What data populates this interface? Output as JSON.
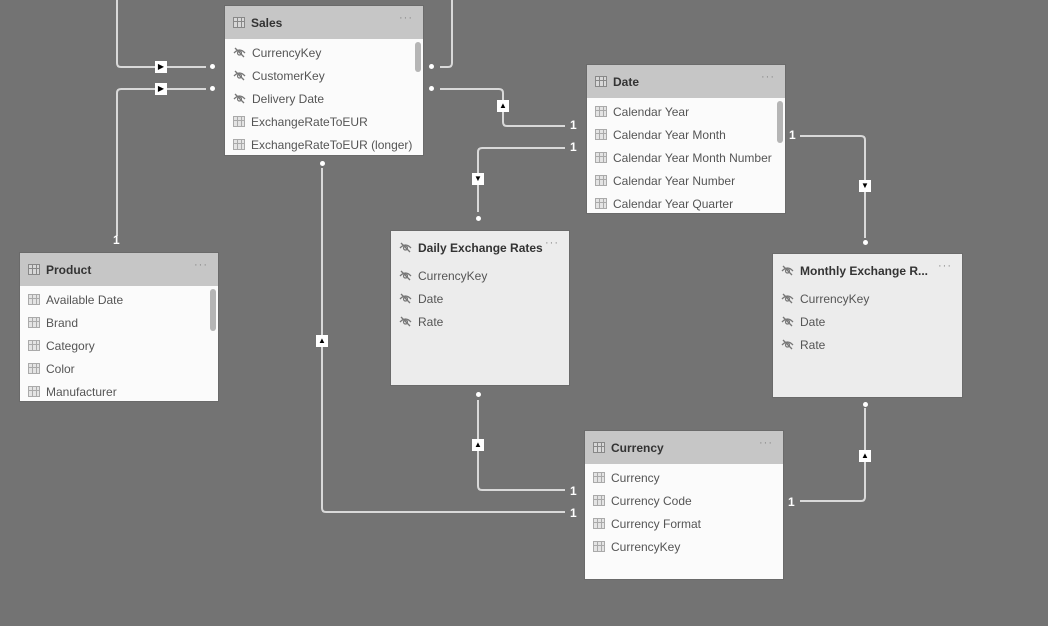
{
  "tables": {
    "sales": {
      "title": "Sales",
      "more": "···",
      "fields": [
        {
          "label": "CurrencyKey",
          "icon": "hidden"
        },
        {
          "label": "CustomerKey",
          "icon": "hidden"
        },
        {
          "label": "Delivery Date",
          "icon": "hidden"
        },
        {
          "label": "ExchangeRateToEUR",
          "icon": "column"
        },
        {
          "label": "ExchangeRateToEUR (longer)",
          "icon": "column"
        }
      ]
    },
    "date": {
      "title": "Date",
      "more": "···",
      "fields": [
        {
          "label": "Calendar Year",
          "icon": "column"
        },
        {
          "label": "Calendar Year Month",
          "icon": "column"
        },
        {
          "label": "Calendar Year Month Number",
          "icon": "column"
        },
        {
          "label": "Calendar Year Number",
          "icon": "column"
        },
        {
          "label": "Calendar Year Quarter",
          "icon": "column"
        }
      ]
    },
    "product": {
      "title": "Product",
      "more": "···",
      "fields": [
        {
          "label": "Available Date",
          "icon": "column"
        },
        {
          "label": "Brand",
          "icon": "column"
        },
        {
          "label": "Category",
          "icon": "column"
        },
        {
          "label": "Color",
          "icon": "column"
        },
        {
          "label": "Manufacturer",
          "icon": "column"
        }
      ]
    },
    "daily": {
      "title": "Daily Exchange Rates",
      "more": "···",
      "hidden": true,
      "fields": [
        {
          "label": "CurrencyKey",
          "icon": "hidden"
        },
        {
          "label": "Date",
          "icon": "hidden"
        },
        {
          "label": "Rate",
          "icon": "hidden"
        }
      ]
    },
    "monthly": {
      "title": "Monthly Exchange R...",
      "more": "···",
      "hidden": true,
      "fields": [
        {
          "label": "CurrencyKey",
          "icon": "hidden"
        },
        {
          "label": "Date",
          "icon": "hidden"
        },
        {
          "label": "Rate",
          "icon": "hidden"
        }
      ]
    },
    "currency": {
      "title": "Currency",
      "more": "···",
      "fields": [
        {
          "label": "Currency",
          "icon": "column"
        },
        {
          "label": "Currency Code",
          "icon": "column"
        },
        {
          "label": "Currency Format",
          "icon": "column"
        },
        {
          "label": "CurrencyKey",
          "icon": "column"
        }
      ]
    }
  },
  "relationships": {
    "one_label": "1",
    "filter_right": "▶",
    "filter_up": "▲",
    "filter_down": "▼"
  }
}
